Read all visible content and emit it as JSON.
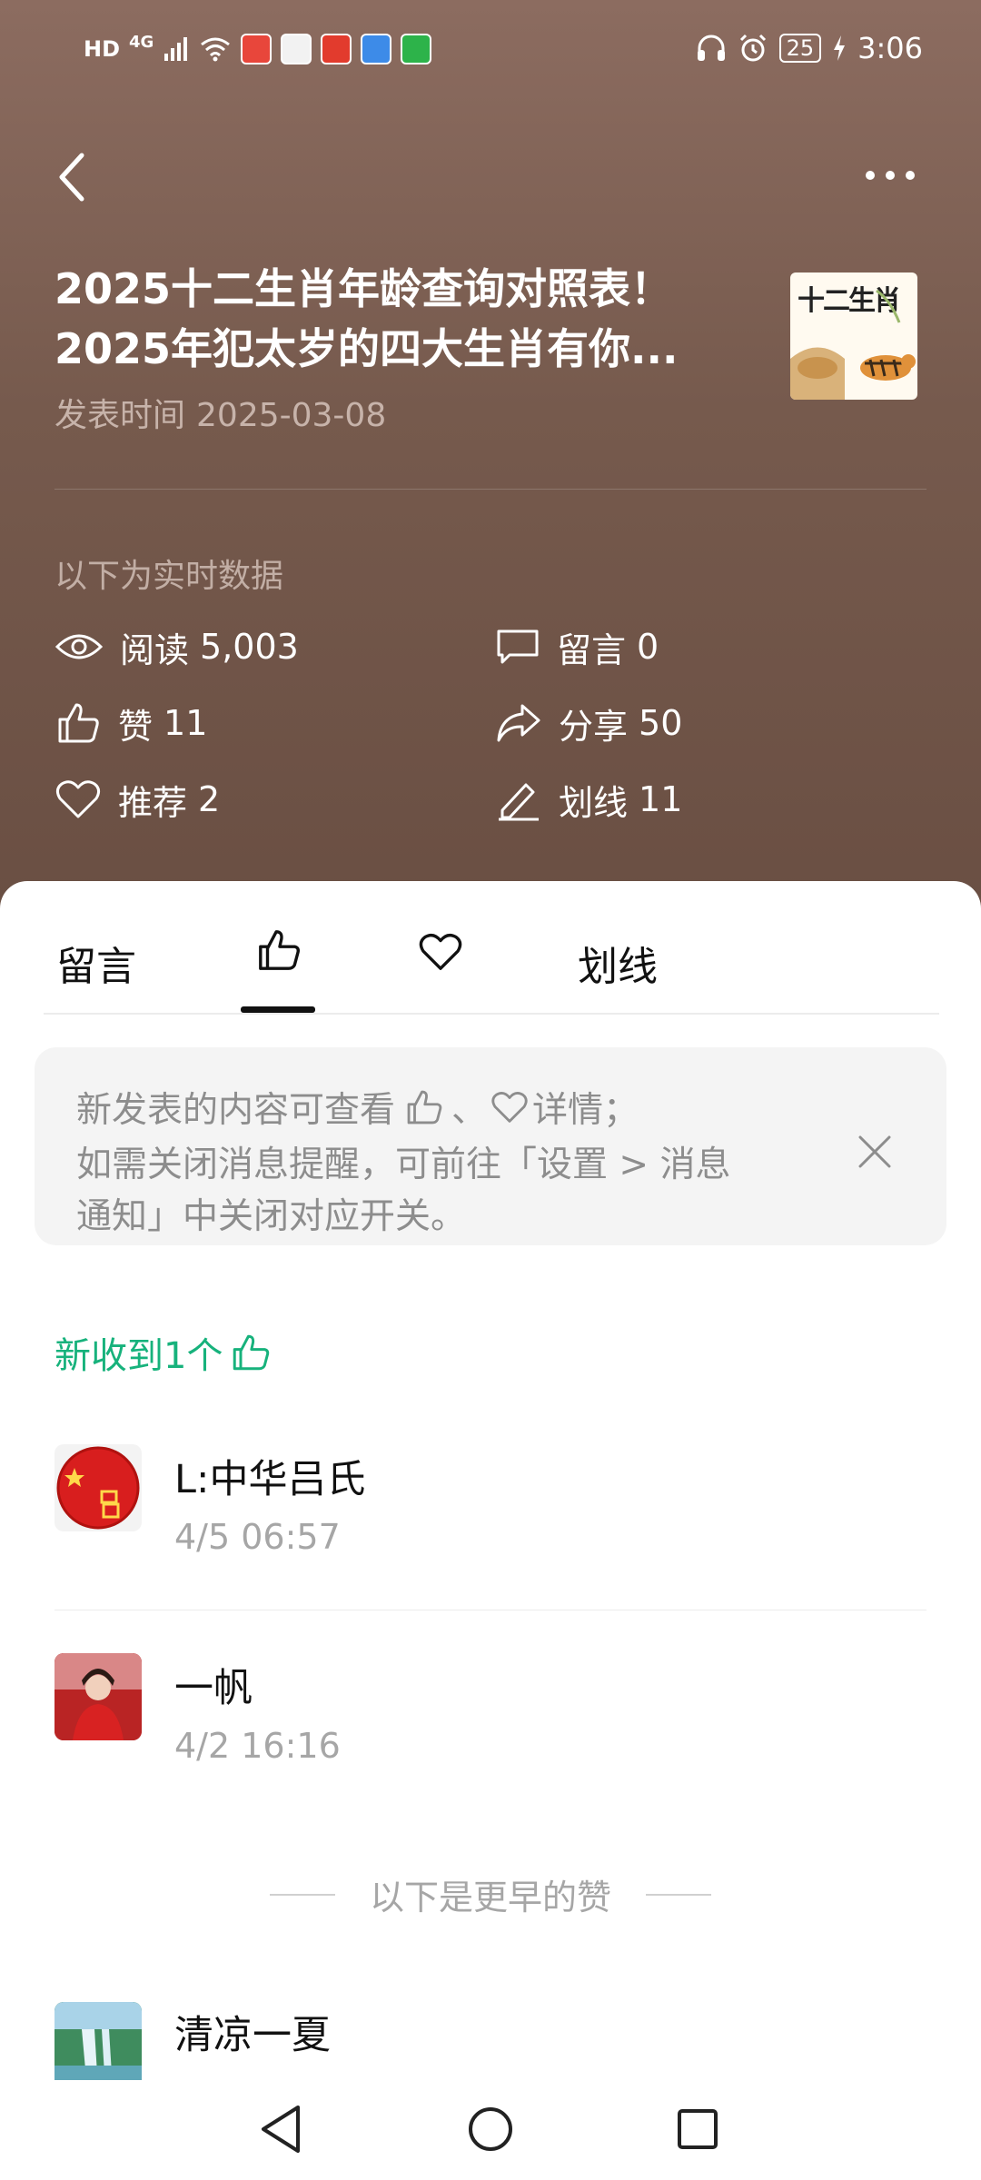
{
  "status_bar": {
    "left_text": "HD",
    "network": "4G",
    "battery": "25",
    "time": "3:06"
  },
  "header": {
    "title_line1": "2025十二生肖年龄查询对照表！",
    "title_line2": "2025年犯太岁的四大生肖有你...",
    "publish_label": "发表时间",
    "publish_date": "2025-03-08",
    "thumbnail_text": "十二生肖",
    "realtime_label": "以下为实时数据"
  },
  "stats": {
    "read": {
      "label": "阅读",
      "value": "5,003"
    },
    "comment": {
      "label": "留言",
      "value": "0"
    },
    "like": {
      "label": "赞",
      "value": "11"
    },
    "share": {
      "label": "分享",
      "value": "50"
    },
    "recommend": {
      "label": "推荐",
      "value": "2"
    },
    "underline": {
      "label": "划线",
      "value": "11"
    }
  },
  "tabs": {
    "comments": "留言",
    "highlights": "划线"
  },
  "notice": {
    "line1_pre": "新发表的内容可查看",
    "line1_sep": "、",
    "line1_post": "详情；",
    "line2": "如需关闭消息提醒，可前往「设置 > 消息",
    "line3": "通知」中关闭对应开关。"
  },
  "new_received": "新收到1个",
  "likes": [
    {
      "name": "L:中华吕氏",
      "time": "4/5 06:57"
    },
    {
      "name": "一帆",
      "time": "4/2 16:16"
    }
  ],
  "earlier_label": "以下是更早的赞",
  "earlier_likes": [
    {
      "name": "清凉一夏"
    }
  ],
  "colors": {
    "header_bg": "#7a5e52",
    "accent_green": "#17b27c"
  }
}
